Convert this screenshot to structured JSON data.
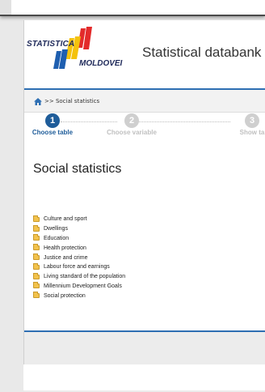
{
  "header": {
    "logo_text_top": "STATISTICA",
    "logo_text_bottom": "MOLDOVEI",
    "title": "Statistical databank"
  },
  "breadcrumb": {
    "text": ">> Social statistics"
  },
  "steps": [
    {
      "number": "1",
      "label": "Choose table"
    },
    {
      "number": "2",
      "label": "Choose variable"
    },
    {
      "number": "3",
      "label": "Show ta"
    }
  ],
  "main": {
    "heading": "Social statistics",
    "folders": [
      "Culture and sport",
      "Dwellings",
      "Education",
      "Health protection",
      "Justice and crime",
      "Labour force and earnings",
      "Living standard of the population",
      "Millennium Development Goals",
      "Social protection"
    ]
  },
  "colors": {
    "accent_blue": "#2e6fb3",
    "step_active": "#1f5d9a",
    "step_inactive": "#cfcfcf",
    "logo_red": "#e32b2b",
    "logo_yellow": "#f4c20d",
    "logo_blue": "#1f5fb0"
  }
}
